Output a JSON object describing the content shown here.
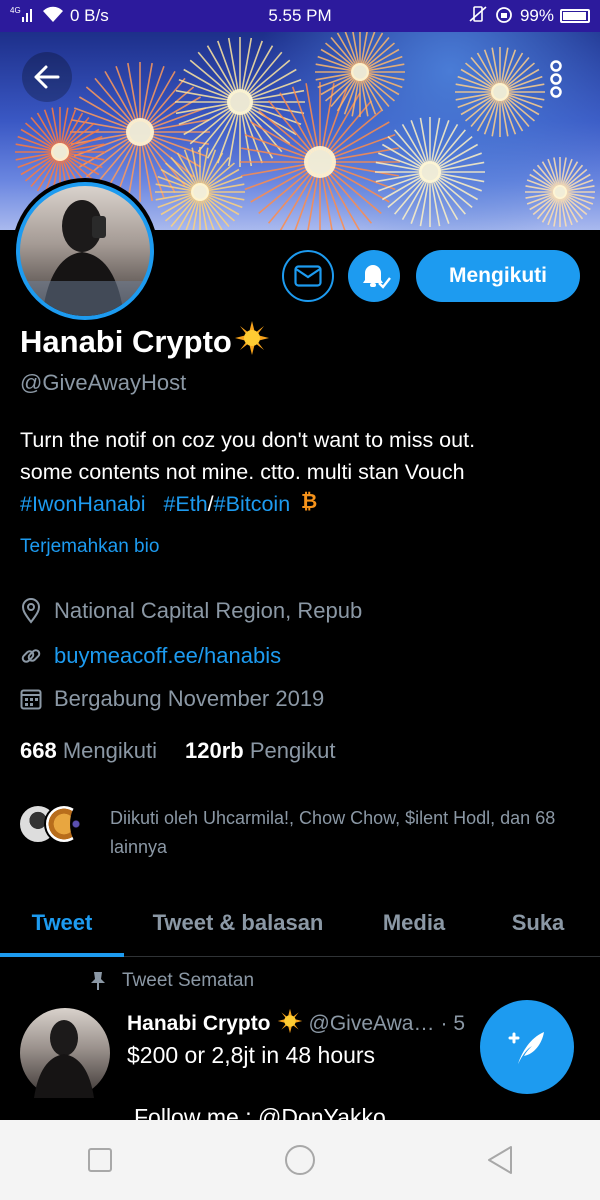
{
  "status_bar": {
    "network": "4G",
    "speed": "0 B/s",
    "time": "5.55 PM",
    "battery": "99%"
  },
  "profile": {
    "name": "Hanabi Crypto",
    "name_emoji": "🌟",
    "handle": "@GiveAwayHost",
    "bio_line1": "Turn the notif on coz you don't want to miss out.",
    "bio_line2": "some contents not mine. ctto. multi stan Vouch",
    "hashtag1": "#IwonHanabi",
    "hashtag2": "#Eth",
    "separator": "/",
    "hashtag3": "#Bitcoin",
    "translate_bio": "Terjemahkan bio",
    "location": "National Capital Region, Repub",
    "website": "buymeacoff.ee/hanabis",
    "joined": "Bergabung November 2019",
    "following_count": "668",
    "following_label": "Mengikuti",
    "followers_count": "120rb",
    "followers_label": "Pengikut",
    "followed_by": "Diikuti oleh Uhcarmila!, Chow Chow, $ilent Hodl, dan 68 lainnya"
  },
  "actions": {
    "follow_label": "Mengikuti"
  },
  "tabs": [
    {
      "label": "Tweet",
      "active": true
    },
    {
      "label": "Tweet & balasan",
      "active": false
    },
    {
      "label": "Media",
      "active": false
    },
    {
      "label": "Suka",
      "active": false
    }
  ],
  "tweet": {
    "pinned_label": "Tweet Sematan",
    "author": "Hanabi Crypto",
    "author_emoji": "🌟",
    "handle": "@GiveAwa…",
    "time": "· 5",
    "text": "$200 or 2,8jt in 48 hours",
    "text2": "Follow me : @DonYakko"
  },
  "colors": {
    "accent": "#1d9bf0",
    "background": "#000000",
    "muted": "#8b98a5",
    "status_bar": "#2c1a9c"
  }
}
